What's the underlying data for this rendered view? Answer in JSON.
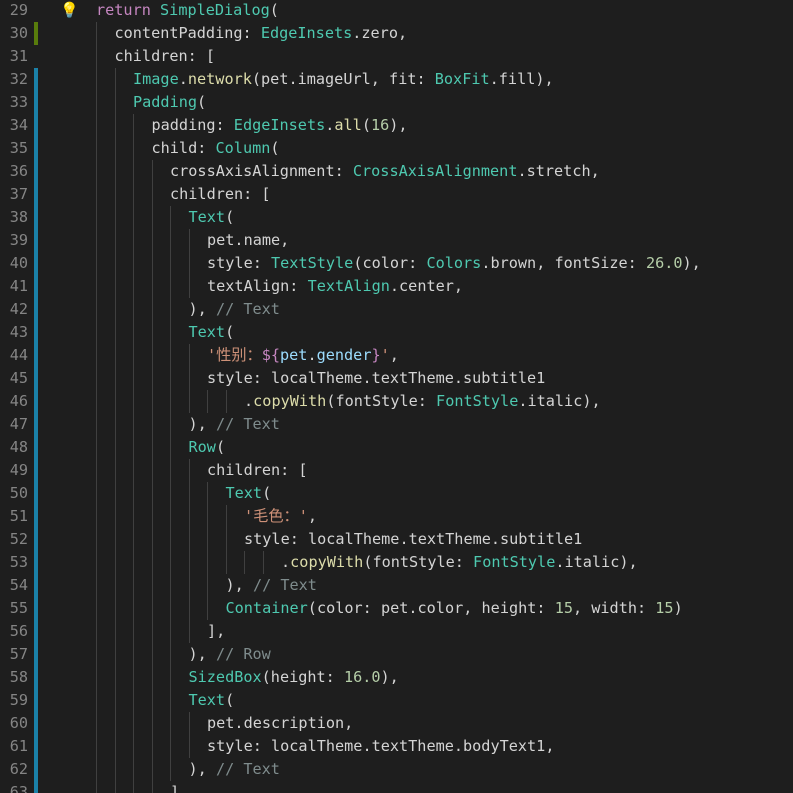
{
  "editor": {
    "colors": {
      "background": "#1e1e1e",
      "line_number": "#858585",
      "default": "#d4d4d4",
      "keyword": "#c586c0",
      "type": "#4ec9b0",
      "function": "#dcdcaa",
      "string": "#ce9178",
      "number": "#b5cea8",
      "variable": "#9cdcfe",
      "comment": "#7f8c8d",
      "indent_guide": "#404040",
      "gutter_modified": "#1b81a8",
      "gutter_added": "#587c0c",
      "lightbulb": "#ffcc00"
    },
    "lightbulb_icon": "lightbulb-icon",
    "lines": [
      {
        "num": "29",
        "indent": 0,
        "gutter": "none",
        "bulb": true,
        "tokens": [
          {
            "t": "return",
            "c": "keyword"
          },
          {
            "t": " "
          },
          {
            "t": "SimpleDialog",
            "c": "type"
          },
          {
            "t": "("
          }
        ]
      },
      {
        "num": "30",
        "indent": 1,
        "gutter": "added",
        "tokens": [
          {
            "t": "contentPadding: "
          },
          {
            "t": "EdgeInsets",
            "c": "type"
          },
          {
            "t": ".zero,"
          }
        ]
      },
      {
        "num": "31",
        "indent": 1,
        "gutter": "none",
        "tokens": [
          {
            "t": "children: ["
          }
        ]
      },
      {
        "num": "32",
        "indent": 2,
        "gutter": "modified",
        "tokens": [
          {
            "t": "Image",
            "c": "type"
          },
          {
            "t": "."
          },
          {
            "t": "network",
            "c": "function"
          },
          {
            "t": "(pet.imageUrl, fit: "
          },
          {
            "t": "BoxFit",
            "c": "type"
          },
          {
            "t": ".fill),"
          }
        ]
      },
      {
        "num": "33",
        "indent": 2,
        "gutter": "modified",
        "tokens": [
          {
            "t": "Padding",
            "c": "type"
          },
          {
            "t": "("
          }
        ]
      },
      {
        "num": "34",
        "indent": 3,
        "gutter": "modified",
        "tokens": [
          {
            "t": "padding: "
          },
          {
            "t": "EdgeInsets",
            "c": "type"
          },
          {
            "t": "."
          },
          {
            "t": "all",
            "c": "function"
          },
          {
            "t": "("
          },
          {
            "t": "16",
            "c": "number"
          },
          {
            "t": "),"
          }
        ]
      },
      {
        "num": "35",
        "indent": 3,
        "gutter": "modified",
        "tokens": [
          {
            "t": "child: "
          },
          {
            "t": "Column",
            "c": "type"
          },
          {
            "t": "("
          }
        ]
      },
      {
        "num": "36",
        "indent": 4,
        "gutter": "modified",
        "tokens": [
          {
            "t": "crossAxisAlignment: "
          },
          {
            "t": "CrossAxisAlignment",
            "c": "type"
          },
          {
            "t": ".stretch,"
          }
        ]
      },
      {
        "num": "37",
        "indent": 4,
        "gutter": "modified",
        "tokens": [
          {
            "t": "children: ["
          }
        ]
      },
      {
        "num": "38",
        "indent": 5,
        "gutter": "modified",
        "tokens": [
          {
            "t": "Text",
            "c": "type"
          },
          {
            "t": "("
          }
        ]
      },
      {
        "num": "39",
        "indent": 6,
        "gutter": "modified",
        "tokens": [
          {
            "t": "pet.name,"
          }
        ]
      },
      {
        "num": "40",
        "indent": 6,
        "gutter": "modified",
        "tokens": [
          {
            "t": "style: "
          },
          {
            "t": "TextStyle",
            "c": "type"
          },
          {
            "t": "(color: "
          },
          {
            "t": "Colors",
            "c": "type"
          },
          {
            "t": ".brown, fontSize: "
          },
          {
            "t": "26.0",
            "c": "number"
          },
          {
            "t": "),"
          }
        ]
      },
      {
        "num": "41",
        "indent": 6,
        "gutter": "modified",
        "tokens": [
          {
            "t": "textAlign: "
          },
          {
            "t": "TextAlign",
            "c": "type"
          },
          {
            "t": ".center,"
          }
        ]
      },
      {
        "num": "42",
        "indent": 5,
        "gutter": "modified",
        "tokens": [
          {
            "t": "), "
          },
          {
            "t": "// Text",
            "c": "comment"
          }
        ]
      },
      {
        "num": "43",
        "indent": 5,
        "gutter": "modified",
        "tokens": [
          {
            "t": "Text",
            "c": "type"
          },
          {
            "t": "("
          }
        ]
      },
      {
        "num": "44",
        "indent": 6,
        "gutter": "modified",
        "tokens": [
          {
            "t": "'性别：",
            "c": "string"
          },
          {
            "t": "${",
            "c": "keyword"
          },
          {
            "t": "pet",
            "c": "variable"
          },
          {
            "t": "."
          },
          {
            "t": "gender",
            "c": "variable"
          },
          {
            "t": "}",
            "c": "keyword"
          },
          {
            "t": "'",
            "c": "string"
          },
          {
            "t": ","
          }
        ]
      },
      {
        "num": "45",
        "indent": 6,
        "gutter": "modified",
        "tokens": [
          {
            "t": "style: localTheme.textTheme.subtitle1"
          }
        ]
      },
      {
        "num": "46",
        "indent": 8,
        "gutter": "modified",
        "tokens": [
          {
            "t": "."
          },
          {
            "t": "copyWith",
            "c": "function"
          },
          {
            "t": "(fontStyle: "
          },
          {
            "t": "FontStyle",
            "c": "type"
          },
          {
            "t": ".italic),"
          }
        ]
      },
      {
        "num": "47",
        "indent": 5,
        "gutter": "modified",
        "tokens": [
          {
            "t": "), "
          },
          {
            "t": "// Text",
            "c": "comment"
          }
        ]
      },
      {
        "num": "48",
        "indent": 5,
        "gutter": "modified",
        "tokens": [
          {
            "t": "Row",
            "c": "type"
          },
          {
            "t": "("
          }
        ]
      },
      {
        "num": "49",
        "indent": 6,
        "gutter": "modified",
        "tokens": [
          {
            "t": "children: ["
          }
        ]
      },
      {
        "num": "50",
        "indent": 7,
        "gutter": "modified",
        "tokens": [
          {
            "t": "Text",
            "c": "type"
          },
          {
            "t": "("
          }
        ]
      },
      {
        "num": "51",
        "indent": 8,
        "gutter": "modified",
        "tokens": [
          {
            "t": "'毛色：'",
            "c": "string"
          },
          {
            "t": ","
          }
        ]
      },
      {
        "num": "52",
        "indent": 8,
        "gutter": "modified",
        "tokens": [
          {
            "t": "style: localTheme.textTheme.subtitle1"
          }
        ]
      },
      {
        "num": "53",
        "indent": 10,
        "gutter": "modified",
        "tokens": [
          {
            "t": "."
          },
          {
            "t": "copyWith",
            "c": "function"
          },
          {
            "t": "(fontStyle: "
          },
          {
            "t": "FontStyle",
            "c": "type"
          },
          {
            "t": ".italic),"
          }
        ]
      },
      {
        "num": "54",
        "indent": 7,
        "gutter": "modified",
        "tokens": [
          {
            "t": "), "
          },
          {
            "t": "// Text",
            "c": "comment"
          }
        ]
      },
      {
        "num": "55",
        "indent": 7,
        "gutter": "modified",
        "tokens": [
          {
            "t": "Container",
            "c": "type"
          },
          {
            "t": "(color: pet.color, height: "
          },
          {
            "t": "15",
            "c": "number"
          },
          {
            "t": ", width: "
          },
          {
            "t": "15",
            "c": "number"
          },
          {
            "t": ")"
          }
        ]
      },
      {
        "num": "56",
        "indent": 6,
        "gutter": "modified",
        "tokens": [
          {
            "t": "],"
          }
        ]
      },
      {
        "num": "57",
        "indent": 5,
        "gutter": "modified",
        "tokens": [
          {
            "t": "), "
          },
          {
            "t": "// Row",
            "c": "comment"
          }
        ]
      },
      {
        "num": "58",
        "indent": 5,
        "gutter": "modified",
        "tokens": [
          {
            "t": "SizedBox",
            "c": "type"
          },
          {
            "t": "(height: "
          },
          {
            "t": "16.0",
            "c": "number"
          },
          {
            "t": "),"
          }
        ]
      },
      {
        "num": "59",
        "indent": 5,
        "gutter": "modified",
        "tokens": [
          {
            "t": "Text",
            "c": "type"
          },
          {
            "t": "("
          }
        ]
      },
      {
        "num": "60",
        "indent": 6,
        "gutter": "modified",
        "tokens": [
          {
            "t": "pet.description,"
          }
        ]
      },
      {
        "num": "61",
        "indent": 6,
        "gutter": "modified",
        "tokens": [
          {
            "t": "style: localTheme.textTheme.bodyText1,"
          }
        ]
      },
      {
        "num": "62",
        "indent": 5,
        "gutter": "modified",
        "tokens": [
          {
            "t": "), "
          },
          {
            "t": "// Text",
            "c": "comment"
          }
        ]
      },
      {
        "num": "63",
        "indent": 4,
        "gutter": "modified",
        "tokens": [
          {
            "t": "],"
          }
        ]
      }
    ]
  }
}
